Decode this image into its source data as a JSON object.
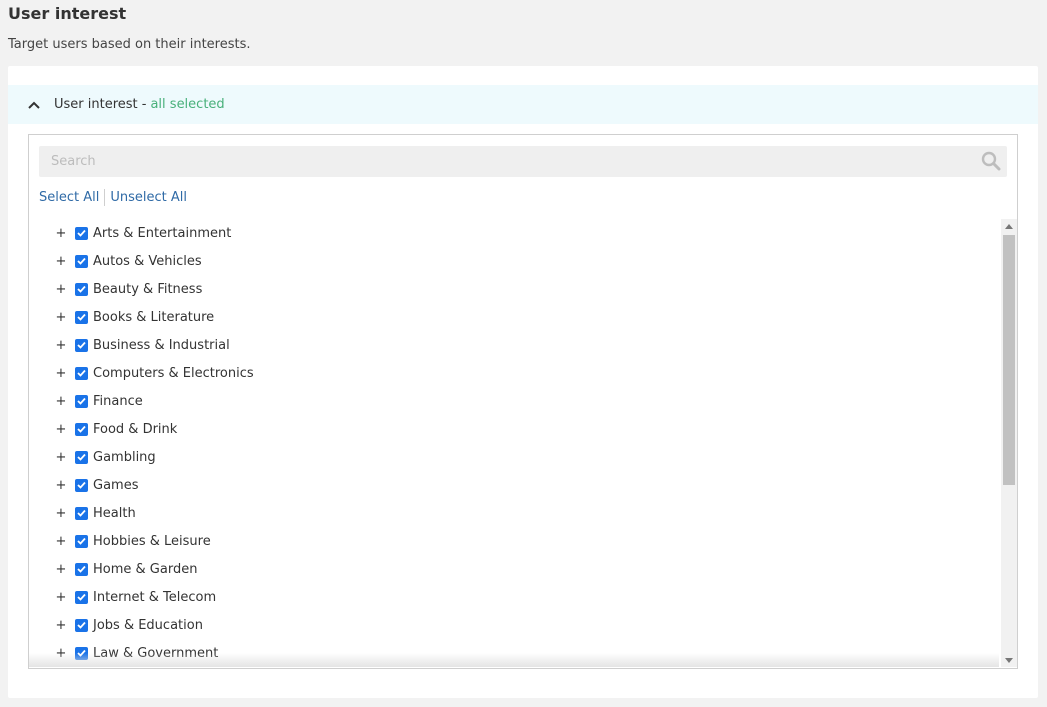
{
  "page": {
    "title": "User interest",
    "description": "Target users based on their interests."
  },
  "panel": {
    "header_label": "User interest -",
    "header_status": "all selected",
    "chevron_icon": "chevron-up-icon",
    "status_color": "#48b07a"
  },
  "search": {
    "placeholder": "Search",
    "value": "",
    "icon": "search-icon"
  },
  "actions": {
    "select_all": "Select All",
    "unselect_all": "Unselect All"
  },
  "interests": [
    {
      "label": "Arts & Entertainment",
      "checked": true
    },
    {
      "label": "Autos & Vehicles",
      "checked": true
    },
    {
      "label": "Beauty & Fitness",
      "checked": true
    },
    {
      "label": "Books & Literature",
      "checked": true
    },
    {
      "label": "Business & Industrial",
      "checked": true
    },
    {
      "label": "Computers & Electronics",
      "checked": true
    },
    {
      "label": "Finance",
      "checked": true
    },
    {
      "label": "Food & Drink",
      "checked": true
    },
    {
      "label": "Gambling",
      "checked": true
    },
    {
      "label": "Games",
      "checked": true
    },
    {
      "label": "Health",
      "checked": true
    },
    {
      "label": "Hobbies & Leisure",
      "checked": true
    },
    {
      "label": "Home & Garden",
      "checked": true
    },
    {
      "label": "Internet & Telecom",
      "checked": true
    },
    {
      "label": "Jobs & Education",
      "checked": true
    },
    {
      "label": "Law & Government",
      "checked": true
    }
  ],
  "expand_symbol": "+",
  "colors": {
    "checkbox": "#1a73e8",
    "link": "#2f6aa6",
    "header_bg": "#eefafd"
  }
}
